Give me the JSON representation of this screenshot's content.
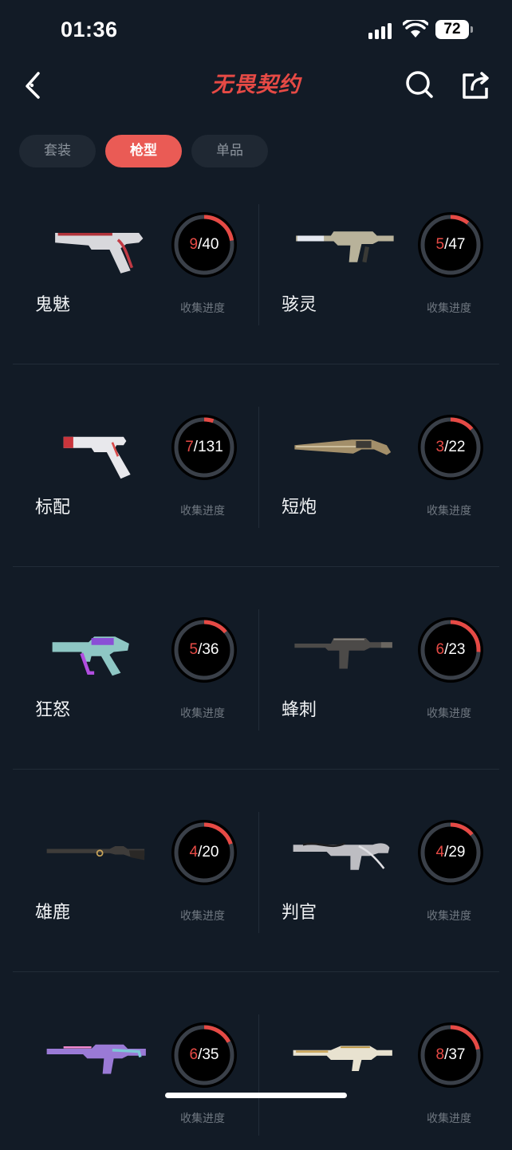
{
  "status_bar": {
    "time": "01:36",
    "battery": "72"
  },
  "nav": {
    "title": "无畏契约"
  },
  "tabs": [
    {
      "label": "套装",
      "active": false
    },
    {
      "label": "枪型",
      "active": true
    },
    {
      "label": "单品",
      "active": false
    }
  ],
  "progress_label": "收集进度",
  "colors": {
    "accent": "#e64a45",
    "background": "#121b26",
    "ring_track": "#3a4049"
  },
  "weapons": [
    {
      "name": "鬼魅",
      "owned": "9",
      "total": "40",
      "fraction": 0.225,
      "icon": "ghost-pistol-icon"
    },
    {
      "name": "骇灵",
      "owned": "5",
      "total": "47",
      "fraction": 0.106,
      "icon": "spectre-smg-icon"
    },
    {
      "name": "标配",
      "owned": "7",
      "total": "131",
      "fraction": 0.053,
      "icon": "classic-pistol-icon"
    },
    {
      "name": "短炮",
      "owned": "3",
      "total": "22",
      "fraction": 0.136,
      "icon": "bucky-shotgun-icon"
    },
    {
      "name": "狂怒",
      "owned": "5",
      "total": "36",
      "fraction": 0.139,
      "icon": "frenzy-pistol-icon"
    },
    {
      "name": "蜂刺",
      "owned": "6",
      "total": "23",
      "fraction": 0.261,
      "icon": "stinger-smg-icon"
    },
    {
      "name": "雄鹿",
      "owned": "4",
      "total": "20",
      "fraction": 0.2,
      "icon": "marshal-rifle-icon"
    },
    {
      "name": "判官",
      "owned": "4",
      "total": "29",
      "fraction": 0.138,
      "icon": "judge-shotgun-icon"
    },
    {
      "name": "",
      "owned": "6",
      "total": "35",
      "fraction": 0.171,
      "icon": "rifle-purple-icon"
    },
    {
      "name": "",
      "owned": "8",
      "total": "37",
      "fraction": 0.216,
      "icon": "rifle-gold-icon"
    }
  ]
}
